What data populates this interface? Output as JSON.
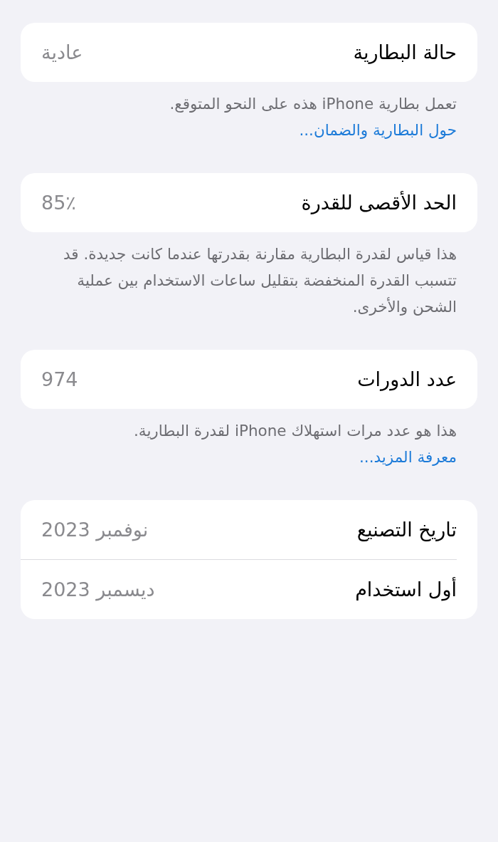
{
  "sections": [
    {
      "rows": [
        {
          "label": "حالة البطارية",
          "value": "عادية"
        }
      ],
      "footer": {
        "text": "تعمل بطارية iPhone هذه على النحو المتوقع.",
        "link": "حول البطارية والضمان..."
      }
    },
    {
      "rows": [
        {
          "label": "الحد الأقصى للقدرة",
          "value": "85٪"
        }
      ],
      "footer": {
        "text": "هذا قياس لقدرة البطارية مقارنة بقدرتها عندما كانت جديدة. قد تتسبب القدرة المنخفضة بتقليل ساعات الاستخدام بين عملية الشحن والأخرى."
      }
    },
    {
      "rows": [
        {
          "label": "عدد الدورات",
          "value": "974"
        }
      ],
      "footer": {
        "text": "هذا هو عدد مرات استهلاك iPhone لقدرة البطارية.",
        "link": "معرفة المزيد..."
      }
    },
    {
      "rows": [
        {
          "label": "تاريخ التصنيع",
          "value": "نوفمبر 2023"
        },
        {
          "label": "أول استخدام",
          "value": "ديسمبر 2023"
        }
      ]
    }
  ]
}
